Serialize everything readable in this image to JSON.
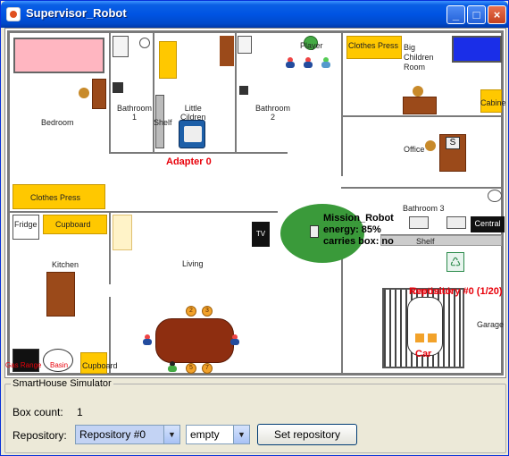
{
  "window": {
    "title": "Supervisor_Robot",
    "min_label": "_",
    "max_label": "□",
    "close_label": "×"
  },
  "rooms": {
    "bedroom": "Bedroom",
    "bathroom1": "Bathroom\n1",
    "little_children": "Little\nCildren",
    "shelf_small": "Shelf",
    "bathroom2": "Bathroom\n2",
    "player": "Player",
    "clothes_press_top": "Clothes Press",
    "big_children": "Big\nChildren\nRoom",
    "cabinet": "Cabinet",
    "office": "Office",
    "clothes_press_left": "Clothes Press",
    "fridge": "Fridge",
    "cupboard_top": "Cupboard",
    "kitchen": "Kitchen",
    "living": "Living",
    "tv": "TV",
    "bathroom3": "Bathroom 3",
    "central": "Central",
    "shelf_large": "Shelf",
    "garage": "Garage",
    "car": "Car",
    "gas_range": "Gas Range",
    "basin": "Basin",
    "cupboard_bottom": "Cupboard"
  },
  "adapter": "Adapter 0",
  "repository_overlay": "Repository #0 (1/20)",
  "repository_overlay_under": "Cartback",
  "robot": {
    "name": "Mission_Robot",
    "energy": "energy: 85%",
    "carries": "carries box: no"
  },
  "table_seats": [
    "2",
    "3",
    "5",
    "7"
  ],
  "panel": {
    "title": "SmartHouse Simulator",
    "box_count_label": "Box count:",
    "box_count_value": "1",
    "repository_label": "Repository:",
    "repository_selected": "Repository #0",
    "content_selected": "empty",
    "set_button": "Set repository"
  },
  "colors": {
    "title_blue": "#0054e3",
    "robot_green": "#3a9a3a",
    "furniture_yellow": "#ffc800",
    "furniture_brown": "#9b4a1a",
    "label_red": "#e8000a"
  }
}
